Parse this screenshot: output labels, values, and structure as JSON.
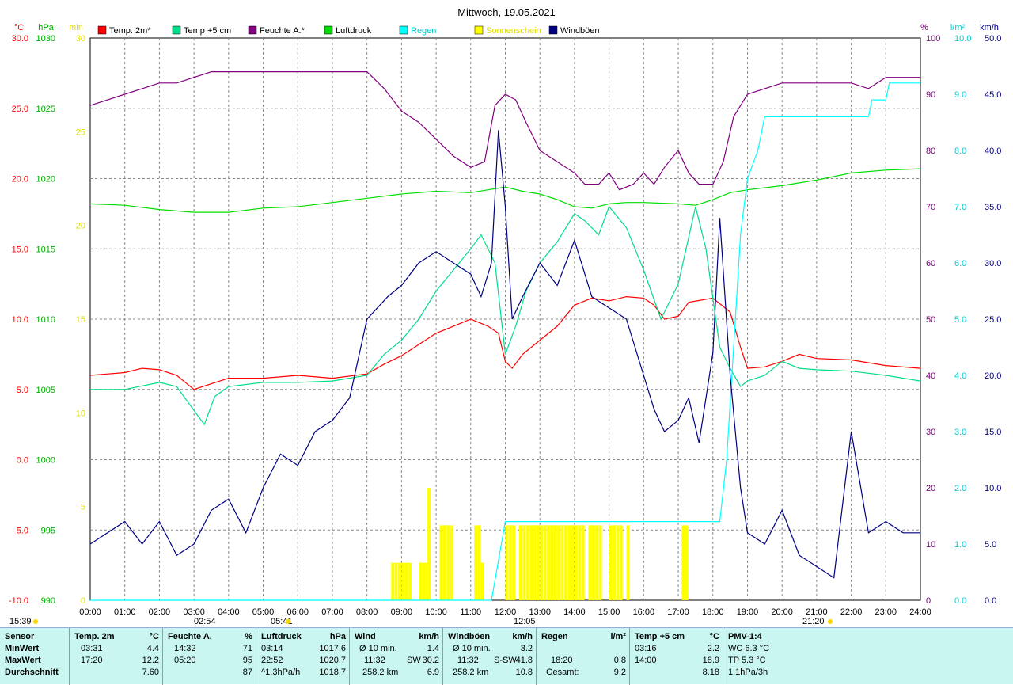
{
  "title": "Mittwoch, 19.05.2021",
  "legend": [
    {
      "label": "Temp. 2m*",
      "color": "#ff0000"
    },
    {
      "label": "Temp +5 cm",
      "color": "#00dd88"
    },
    {
      "label": "Feuchte A.*",
      "color": "#800080"
    },
    {
      "label": "Luftdruck",
      "color": "#00dd00"
    },
    {
      "label": "Regen",
      "color": "#00ffff"
    },
    {
      "label": "Sonnenschein",
      "color": "#ffff00"
    },
    {
      "label": "Windböen",
      "color": "#000080"
    }
  ],
  "axis_units": {
    "temp": "°C",
    "pressure": "hPa",
    "sun": "min",
    "humidity": "%",
    "rain": "l/m²",
    "wind": "km/h"
  },
  "sun_markers": {
    "left_time": "15:39",
    "sunrise": "05:41",
    "sunset": "21:20",
    "min_temp": "02:54",
    "max_gust": "12:05"
  },
  "chart_data": {
    "type": "line",
    "x_range": [
      "00:00",
      "24:00"
    ],
    "x_ticks": [
      "00:00",
      "01:00",
      "02:00",
      "03:00",
      "04:00",
      "05:00",
      "06:00",
      "07:00",
      "08:00",
      "09:00",
      "10:00",
      "11:00",
      "12:00",
      "13:00",
      "14:00",
      "15:00",
      "16:00",
      "17:00",
      "18:00",
      "19:00",
      "20:00",
      "21:00",
      "22:00",
      "23:00",
      "24:00"
    ],
    "axes": {
      "temp": {
        "unit": "°C",
        "range": [
          -10,
          30
        ],
        "ticks": [
          "30.0",
          "25.0",
          "20.0",
          "15.0",
          "10.0",
          "5.0",
          "0.0",
          "-5.0",
          "-10.0"
        ]
      },
      "pressure": {
        "unit": "hPa",
        "range": [
          990,
          1030
        ],
        "ticks": [
          "1030",
          "1025",
          "1020",
          "1015",
          "1010",
          "1005",
          "1000",
          "995",
          "990"
        ]
      },
      "sun": {
        "unit": "min",
        "range": [
          0,
          30
        ],
        "ticks": [
          "30",
          "25",
          "20",
          "15",
          "10",
          "5",
          "0"
        ]
      },
      "humidity": {
        "unit": "%",
        "range": [
          0,
          100
        ],
        "ticks": [
          "100",
          "90",
          "80",
          "70",
          "60",
          "50",
          "40",
          "30",
          "20",
          "10",
          "0"
        ]
      },
      "rain": {
        "unit": "l/m²",
        "range": [
          0,
          10
        ],
        "ticks": [
          "10.0",
          "9.0",
          "8.0",
          "7.0",
          "6.0",
          "5.0",
          "4.0",
          "3.0",
          "2.0",
          "1.0",
          "0.0"
        ]
      },
      "wind": {
        "unit": "km/h",
        "range": [
          0,
          50
        ],
        "ticks": [
          "50.0",
          "45.0",
          "40.0",
          "35.0",
          "30.0",
          "25.0",
          "20.0",
          "15.0",
          "10.0",
          "5.0",
          "0.0"
        ]
      }
    },
    "series": [
      {
        "name": "Temp. 2m*",
        "axis": "temp",
        "color": "#ff0000",
        "x": [
          0,
          1,
          1.5,
          2,
          2.5,
          3.0,
          3.5,
          4,
          5,
          6,
          7,
          8,
          8.5,
          9,
          9.5,
          10,
          10.5,
          11,
          11.5,
          11.8,
          12,
          12.2,
          12.5,
          13,
          13.5,
          14,
          14.5,
          15,
          15.5,
          16,
          16.3,
          16.6,
          17,
          17.3,
          18,
          18.5,
          18.8,
          19,
          19.5,
          20,
          20.5,
          21,
          22,
          23,
          24
        ],
        "y": [
          6.0,
          6.2,
          6.5,
          6.4,
          6.0,
          5.0,
          5.4,
          5.8,
          5.8,
          6.0,
          5.8,
          6.1,
          6.8,
          7.4,
          8.2,
          9.0,
          9.5,
          10.0,
          9.5,
          9.0,
          7.0,
          6.5,
          7.5,
          8.5,
          9.5,
          11.0,
          11.5,
          11.3,
          11.6,
          11.5,
          11.0,
          10.0,
          10.2,
          11.2,
          11.5,
          10.5,
          8.0,
          6.5,
          6.6,
          7.0,
          7.5,
          7.2,
          7.1,
          6.7,
          6.5
        ]
      },
      {
        "name": "Temp +5 cm",
        "axis": "temp",
        "color": "#00dd88",
        "x": [
          0,
          1,
          2,
          2.5,
          3.0,
          3.3,
          3.6,
          4,
          5,
          6,
          7,
          8,
          8.5,
          9,
          9.5,
          10,
          10.5,
          11,
          11.3,
          11.7,
          12,
          12.3,
          12.6,
          13,
          13.5,
          14,
          14.3,
          14.7,
          15,
          15.5,
          16,
          16.5,
          17,
          17.5,
          17.8,
          18.2,
          18.5,
          18.8,
          19,
          19.5,
          20,
          20.5,
          21,
          22,
          23,
          24
        ],
        "y": [
          5.0,
          5.0,
          5.5,
          5.2,
          3.5,
          2.5,
          4.5,
          5.2,
          5.5,
          5.5,
          5.6,
          6.0,
          7.5,
          8.5,
          10.0,
          12.0,
          13.5,
          15.0,
          16.0,
          14.0,
          7.5,
          9.5,
          12.0,
          14.0,
          15.5,
          17.5,
          17.0,
          16.0,
          18.0,
          16.5,
          13.5,
          10.0,
          12.5,
          18.0,
          15.0,
          8.0,
          6.5,
          5.2,
          5.6,
          6.0,
          7.0,
          6.5,
          6.4,
          6.3,
          6.0,
          5.6
        ]
      },
      {
        "name": "Feuchte A.*",
        "axis": "humidity",
        "color": "#800080",
        "x": [
          0,
          0.5,
          1,
          1.5,
          2,
          2.5,
          3,
          3.5,
          4,
          5,
          6,
          7,
          8,
          8.5,
          9,
          9.5,
          10,
          10.5,
          11,
          11.4,
          11.7,
          12,
          12.3,
          12.6,
          13,
          13.5,
          14,
          14.3,
          14.7,
          15,
          15.3,
          15.7,
          16,
          16.3,
          16.6,
          17,
          17.3,
          17.6,
          18,
          18.3,
          18.6,
          19,
          19.5,
          20,
          20.5,
          21,
          21.5,
          22,
          22.5,
          23,
          23.5,
          24
        ],
        "y": [
          88,
          89,
          90,
          91,
          92,
          92,
          93,
          94,
          94,
          94,
          94,
          94,
          94,
          91,
          87,
          85,
          82,
          79,
          77,
          78,
          88,
          90,
          89,
          85,
          80,
          78,
          76,
          74,
          74,
          76,
          73,
          74,
          76,
          74,
          77,
          80,
          76,
          74,
          74,
          78,
          86,
          90,
          91,
          92,
          92,
          92,
          92,
          92,
          91,
          93,
          93,
          93
        ]
      },
      {
        "name": "Luftdruck",
        "axis": "pressure",
        "color": "#00dd00",
        "x": [
          0,
          1,
          2,
          3,
          4,
          5,
          6,
          7,
          8,
          9,
          10,
          11,
          11.5,
          12,
          12.5,
          13,
          13.5,
          14,
          14.5,
          15,
          15.5,
          16,
          17,
          17.5,
          18,
          18.5,
          19,
          20,
          21,
          22,
          23,
          24
        ],
        "y": [
          1018.2,
          1018.1,
          1017.8,
          1017.6,
          1017.6,
          1017.9,
          1018.0,
          1018.3,
          1018.6,
          1018.9,
          1019.1,
          1019.0,
          1019.2,
          1019.4,
          1019.1,
          1018.9,
          1018.5,
          1018.0,
          1017.9,
          1018.2,
          1018.3,
          1018.3,
          1018.2,
          1018.1,
          1018.5,
          1019.0,
          1019.2,
          1019.5,
          1019.9,
          1020.4,
          1020.6,
          1020.7
        ]
      },
      {
        "name": "Regen",
        "axis": "rain",
        "color": "#00ffff",
        "x": [
          0,
          11.6,
          12.0,
          18.2,
          18.4,
          18.6,
          18.8,
          19.0,
          19.3,
          19.5,
          20.0,
          21.0,
          22.0,
          22.5,
          22.6,
          23.0,
          23.1,
          24
        ],
        "y": [
          0,
          0,
          1.4,
          1.4,
          2.5,
          4.5,
          6.5,
          7.5,
          8.0,
          8.6,
          8.6,
          8.6,
          8.6,
          8.6,
          8.9,
          8.9,
          9.2,
          9.2
        ]
      },
      {
        "name": "Windböen",
        "axis": "wind",
        "color": "#000080",
        "x": [
          0,
          0.5,
          1,
          1.5,
          2,
          2.5,
          3,
          3.5,
          4,
          4.5,
          5,
          5.5,
          6,
          6.5,
          7,
          7.5,
          8,
          8.3,
          8.6,
          9,
          9.5,
          10,
          10.5,
          11,
          11.3,
          11.6,
          11.8,
          12,
          12.2,
          12.5,
          13,
          13.5,
          14,
          14.5,
          15,
          15.5,
          16,
          16.3,
          16.6,
          17,
          17.3,
          17.6,
          18,
          18.2,
          18.5,
          18.8,
          19,
          19.5,
          20,
          20.5,
          21,
          21.5,
          22,
          22.5,
          23,
          23.5,
          24
        ],
        "y": [
          5,
          6,
          7,
          5,
          7,
          4,
          5,
          8,
          9,
          6,
          10,
          13,
          12,
          15,
          16,
          18,
          25,
          26,
          27,
          28,
          30,
          31,
          30,
          29,
          27,
          30,
          41.8,
          35,
          25,
          27,
          30,
          28,
          32,
          27,
          26,
          25,
          20,
          17,
          15,
          16,
          18,
          14,
          22,
          34,
          20,
          10,
          6,
          5,
          8,
          4,
          3,
          2,
          15,
          6,
          7,
          6,
          6
        ]
      },
      {
        "name": "Sonnenschein",
        "axis": "sun",
        "color": "#ffff00",
        "type": "bar",
        "x": [
          8.7,
          8.8,
          8.9,
          9.0,
          9.1,
          9.2,
          9.5,
          9.6,
          9.7,
          9.75,
          10.1,
          10.2,
          10.3,
          10.4,
          11.1,
          11.2,
          11.3,
          12.0,
          12.1,
          12.2,
          12.4,
          12.5,
          12.6,
          12.7,
          12.8,
          12.9,
          13.0,
          13.1,
          13.2,
          13.3,
          13.4,
          13.5,
          13.6,
          13.7,
          13.8,
          13.9,
          14.0,
          14.1,
          14.2,
          14.4,
          14.5,
          14.6,
          14.7,
          15.0,
          15.1,
          15.2,
          15.3,
          15.5,
          17.1,
          17.2
        ],
        "y": [
          2,
          2,
          2,
          2,
          2,
          2,
          2,
          2,
          2,
          6,
          4,
          4,
          4,
          4,
          4,
          4,
          2,
          4,
          4,
          4,
          4,
          4,
          4,
          4,
          4,
          4,
          4,
          4,
          4,
          4,
          4,
          4,
          4,
          4,
          4,
          4,
          4,
          4,
          4,
          4,
          4,
          4,
          4,
          4,
          4,
          4,
          4,
          4,
          4,
          4
        ]
      }
    ]
  },
  "stats": {
    "sensor": {
      "head": "Sensor",
      "rows": [
        "MinWert",
        "MaxWert",
        "Durchschnitt"
      ]
    },
    "temp2m": {
      "head": "Temp. 2m",
      "unit": "°C",
      "rows": [
        [
          "03:31",
          "4.4"
        ],
        [
          "17:20",
          "12.2"
        ],
        [
          "",
          "7.60"
        ]
      ]
    },
    "feuchte": {
      "head": "Feuchte A.",
      "unit": "%",
      "rows": [
        [
          "14:32",
          "71"
        ],
        [
          "05:20",
          "95"
        ],
        [
          "",
          "87"
        ]
      ]
    },
    "luftdruck": {
      "head": "Luftdruck",
      "unit": "hPa",
      "rows": [
        [
          "03:14",
          "1017.6"
        ],
        [
          "22:52",
          "1020.7"
        ],
        [
          "^1.3hPa/h",
          "1018.7"
        ]
      ]
    },
    "wind": {
      "head": "Wind",
      "unit": "km/h",
      "rows": [
        [
          "Ø 10 min.",
          "",
          "1.4"
        ],
        [
          "11:32",
          "SW",
          "30.2"
        ],
        [
          "258.2 km",
          "",
          "6.9"
        ]
      ]
    },
    "windboeen": {
      "head": "Windböen",
      "unit": "km/h",
      "rows": [
        [
          "Ø 10 min.",
          "",
          "3.2"
        ],
        [
          "11:32",
          "S-SW",
          "41.8"
        ],
        [
          "258.2 km",
          "",
          "10.8"
        ]
      ]
    },
    "regen": {
      "head": "Regen",
      "unit": "l/m²",
      "rows": [
        [
          "",
          ""
        ],
        [
          "18:20",
          "0.8"
        ],
        [
          "Gesamt:",
          "9.2"
        ]
      ]
    },
    "temp5cm": {
      "head": "Temp +5 cm",
      "unit": "°C",
      "rows": [
        [
          "03:16",
          "2.2"
        ],
        [
          "14:00",
          "18.9"
        ],
        [
          "",
          "8.18"
        ]
      ]
    },
    "pmv": {
      "head": "PMV-1:4",
      "rows": [
        "WC 6.3 °C",
        "TP 5.3 °C",
        "1.1hPa/3h"
      ]
    }
  }
}
